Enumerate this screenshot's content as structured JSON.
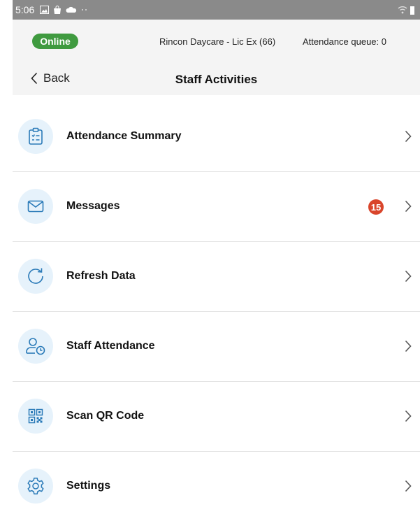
{
  "status_bar": {
    "time": "5:06",
    "left_icons": [
      "image-icon",
      "bag-icon",
      "cloud-icon",
      "dots-icon"
    ],
    "right_icons": [
      "wifi-icon",
      "battery-icon"
    ]
  },
  "header": {
    "connection_status": "Online",
    "connection_color": "#3f9a3f",
    "center_name": "Rincon Daycare - Lic Ex (66)",
    "attendance_queue": "Attendance queue: 0",
    "back_label": "Back",
    "title": "Staff Activities"
  },
  "menu": {
    "items": [
      {
        "label": "Attendance Summary",
        "icon": "clipboard-checklist-icon"
      },
      {
        "label": "Messages",
        "icon": "envelope-icon",
        "badge": "15",
        "badge_color": "#d9452b"
      },
      {
        "label": "Refresh Data",
        "icon": "refresh-icon"
      },
      {
        "label": "Staff Attendance",
        "icon": "user-clock-icon"
      },
      {
        "label": "Scan QR Code",
        "icon": "qr-code-icon"
      },
      {
        "label": "Settings",
        "icon": "gear-icon"
      }
    ]
  },
  "colors": {
    "icon_blue": "#2a7ab8",
    "icon_background": "#e6f2fb",
    "header_background": "#f4f4f4"
  }
}
